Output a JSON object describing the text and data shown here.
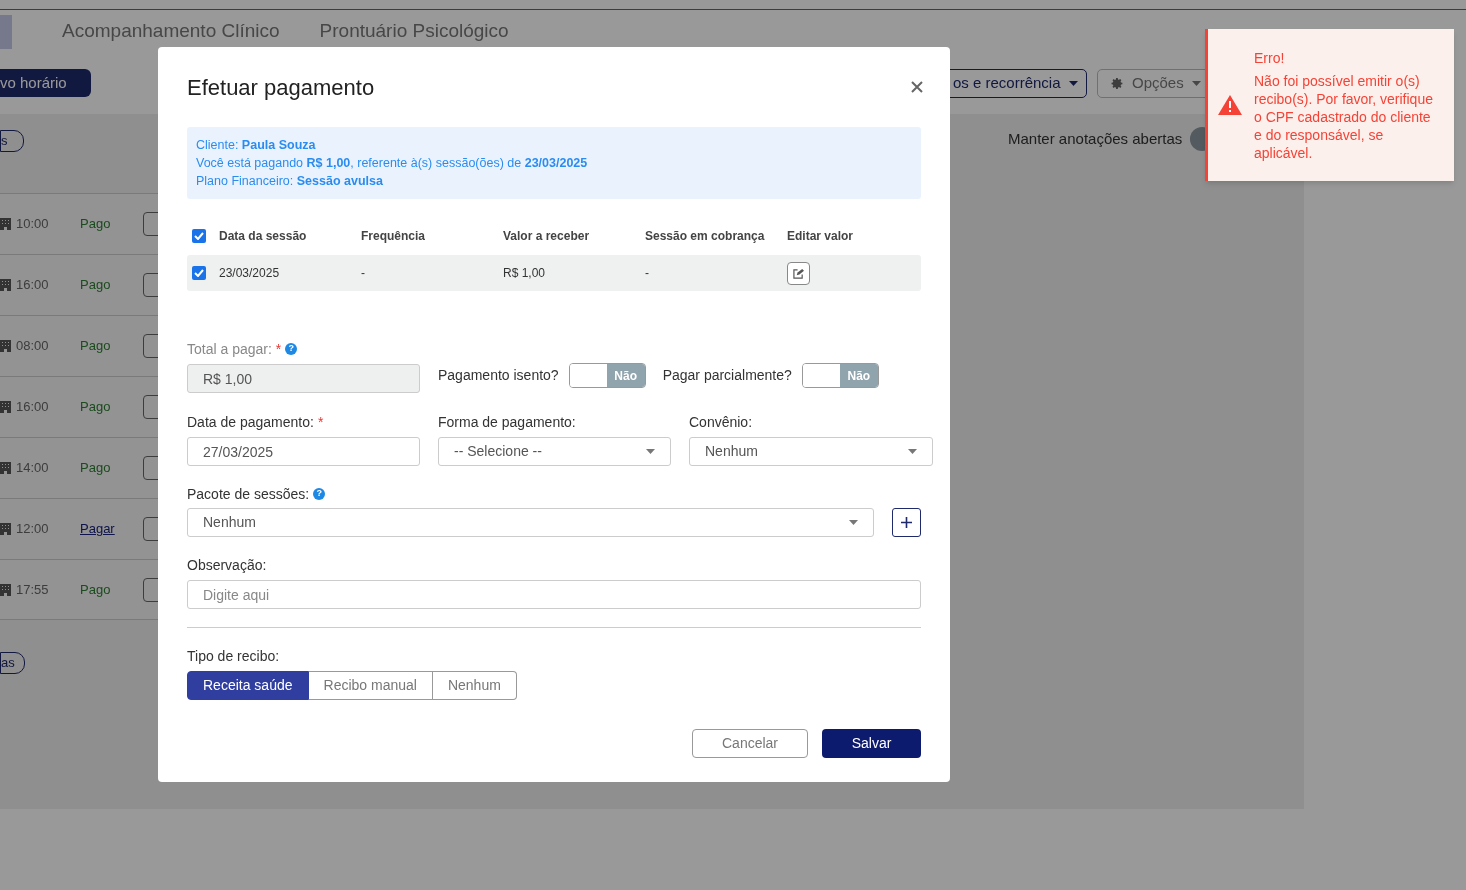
{
  "background": {
    "tabs": [
      {
        "label": "Acompanhamento Clínico"
      },
      {
        "label": "Prontuário Psicológico"
      }
    ],
    "new_time_button": "vo horário",
    "recurrence_button": "os e recorrência",
    "options_button": "Opções",
    "filter_pill_top": "s",
    "filter_pill_bottom": "as",
    "keep_notes_label": "Manter anotações abertas",
    "keep_notes_on": false,
    "appointments": [
      {
        "time": "10:00",
        "status": "Pago",
        "kind": "paid"
      },
      {
        "time": "16:00",
        "status": "Pago",
        "kind": "paid"
      },
      {
        "time": "08:00",
        "status": "Pago",
        "kind": "paid"
      },
      {
        "time": "16:00",
        "status": "Pago",
        "kind": "paid"
      },
      {
        "time": "14:00",
        "status": "Pago",
        "kind": "paid"
      },
      {
        "time": "12:00",
        "status": "Pagar",
        "kind": "link"
      },
      {
        "time": "17:55",
        "status": "Pago",
        "kind": "paid"
      }
    ]
  },
  "modal": {
    "title": "Efetuar pagamento",
    "info": [
      "Cliente: **Paula Souza**",
      "Você está pagando **R$ 1,00**, referente à(s) sessão(ões) de **23/03/2025**",
      "Plano Financeiro: **Sessão avulsa**"
    ],
    "table": {
      "all_checked": true,
      "columns": [
        "Data da sessão",
        "Frequência",
        "Valor a receber",
        "Sessão em cobrança",
        "Editar valor"
      ],
      "rows": [
        {
          "checked": true,
          "date": "23/03/2025",
          "frequency": "-",
          "value": "R$ 1,00",
          "billing": "-"
        }
      ]
    },
    "total": {
      "label": "Total a pagar:",
      "required_mark": "*",
      "help": "?",
      "value": "R$ 1,00",
      "disabled": true
    },
    "exempt": {
      "label": "Pagamento isento?",
      "on": false,
      "text": "Não"
    },
    "partial": {
      "label": "Pagar parcialmente?",
      "on": false,
      "text": "Não"
    },
    "payment_date": {
      "label": "Data de pagamento:",
      "required_mark": "*",
      "value": "27/03/2025"
    },
    "payment_method": {
      "label": "Forma de pagamento:",
      "placeholder": "-- Selecione --"
    },
    "insurance": {
      "label": "Convênio:",
      "value": "Nenhum"
    },
    "package": {
      "label": "Pacote de sessões:",
      "help": "?",
      "value": "Nenhum"
    },
    "notes": {
      "label": "Observação:",
      "placeholder": "Digite aqui"
    },
    "receipt_type": {
      "label": "Tipo de recibo:",
      "options": [
        {
          "label": "Receita saúde",
          "selected": true
        },
        {
          "label": "Recibo manual",
          "selected": false
        },
        {
          "label": "Nenhum",
          "selected": false
        }
      ]
    },
    "cancel_button": "Cancelar",
    "save_button": "Salvar"
  },
  "toast": {
    "title": "Erro!",
    "message": "Não foi possível emitir o(s) recibo(s). Por favor, verifique o CPF cadastrado do cliente e do responsável, se aplicável."
  }
}
